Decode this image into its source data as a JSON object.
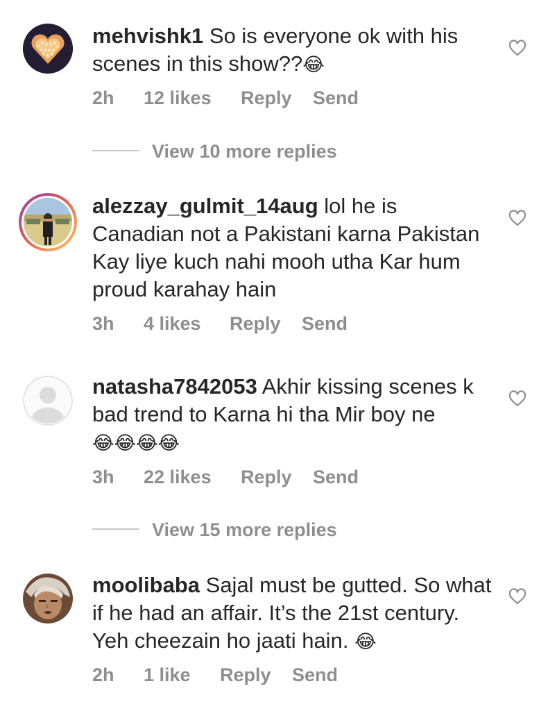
{
  "comments": [
    {
      "username": "mehvishk1",
      "text": "So is everyone ok with his scenes in this show??",
      "emoji": "😂",
      "time": "2h",
      "likes": "12 likes",
      "reply": "Reply",
      "send": "Send",
      "view_replies": "View 10 more replies"
    },
    {
      "username": "alezzay_gulmit_14aug",
      "text": "lol he is Canadian not a Pakistani karna Pakistan Kay liye kuch nahi mooh utha Kar hum proud karahay hain",
      "time": "3h",
      "likes": "4 likes",
      "reply": "Reply",
      "send": "Send"
    },
    {
      "username": "natasha7842053",
      "text": "Akhir kissing scenes k bad trend to Karna hi tha Mir boy ne",
      "emoji": "😂😂😂😂",
      "time": "3h",
      "likes": "22 likes",
      "reply": "Reply",
      "send": "Send",
      "view_replies": "View 15 more replies"
    },
    {
      "username": "moolibaba",
      "text": "Sajal must be gutted. So what if he had an affair.  It’s the 21st century. Yeh cheezain ho jaati hain.",
      "emoji": "😂",
      "time": "2h",
      "likes": "1 like",
      "reply": "Reply",
      "send": "Send"
    }
  ],
  "icons": {
    "like": "heart-outline-icon",
    "default_avatar": "default-avatar-icon"
  },
  "colors": {
    "text": "#262626",
    "secondary": "#8e8e8e",
    "story_ring_start": "#8a3ab9",
    "story_ring_end": "#fccc63"
  }
}
